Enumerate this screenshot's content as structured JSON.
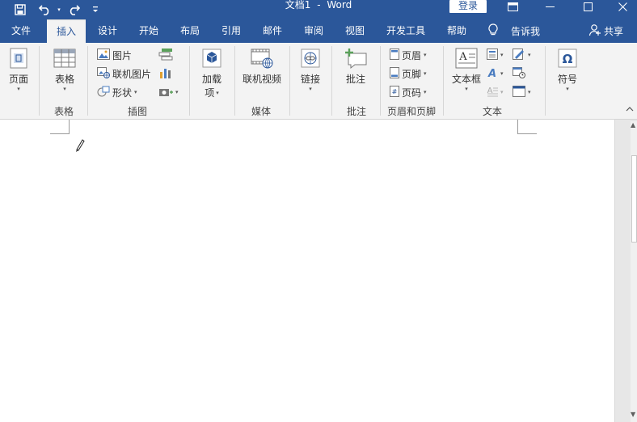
{
  "titlebar": {
    "doc_name": "文档1",
    "separator": "-",
    "app_name": "Word",
    "login_label": "登录"
  },
  "tabs": [
    {
      "label": "文件"
    },
    {
      "label": "插入"
    },
    {
      "label": "设计"
    },
    {
      "label": "开始"
    },
    {
      "label": "布局"
    },
    {
      "label": "引用"
    },
    {
      "label": "邮件"
    },
    {
      "label": "审阅"
    },
    {
      "label": "视图"
    },
    {
      "label": "开发工具"
    },
    {
      "label": "帮助"
    }
  ],
  "active_tab": "插入",
  "tell_me": {
    "label": "告诉我"
  },
  "share": {
    "label": "共享"
  },
  "ribbon": {
    "groups": {
      "pages": {
        "label": "",
        "button": "页面"
      },
      "tables": {
        "label": "表格",
        "button": "表格"
      },
      "illustrations": {
        "label": "插图",
        "picture": "图片",
        "online_picture": "联机图片",
        "shapes": "形状"
      },
      "addins": {
        "label": "",
        "button": "加载",
        "button2": "项"
      },
      "media": {
        "label": "媒体",
        "button": "联机视频"
      },
      "links": {
        "label": "",
        "button": "链接"
      },
      "comments": {
        "label": "批注",
        "button": "批注"
      },
      "header_footer": {
        "label": "页眉和页脚",
        "header": "页眉",
        "footer": "页脚",
        "page_number": "页码"
      },
      "text": {
        "label": "文本",
        "textbox": "文本框"
      },
      "symbols": {
        "label": "",
        "button": "符号"
      }
    }
  },
  "colors": {
    "brand_blue": "#2b579a",
    "ribbon_bg": "#f3f3f3"
  }
}
